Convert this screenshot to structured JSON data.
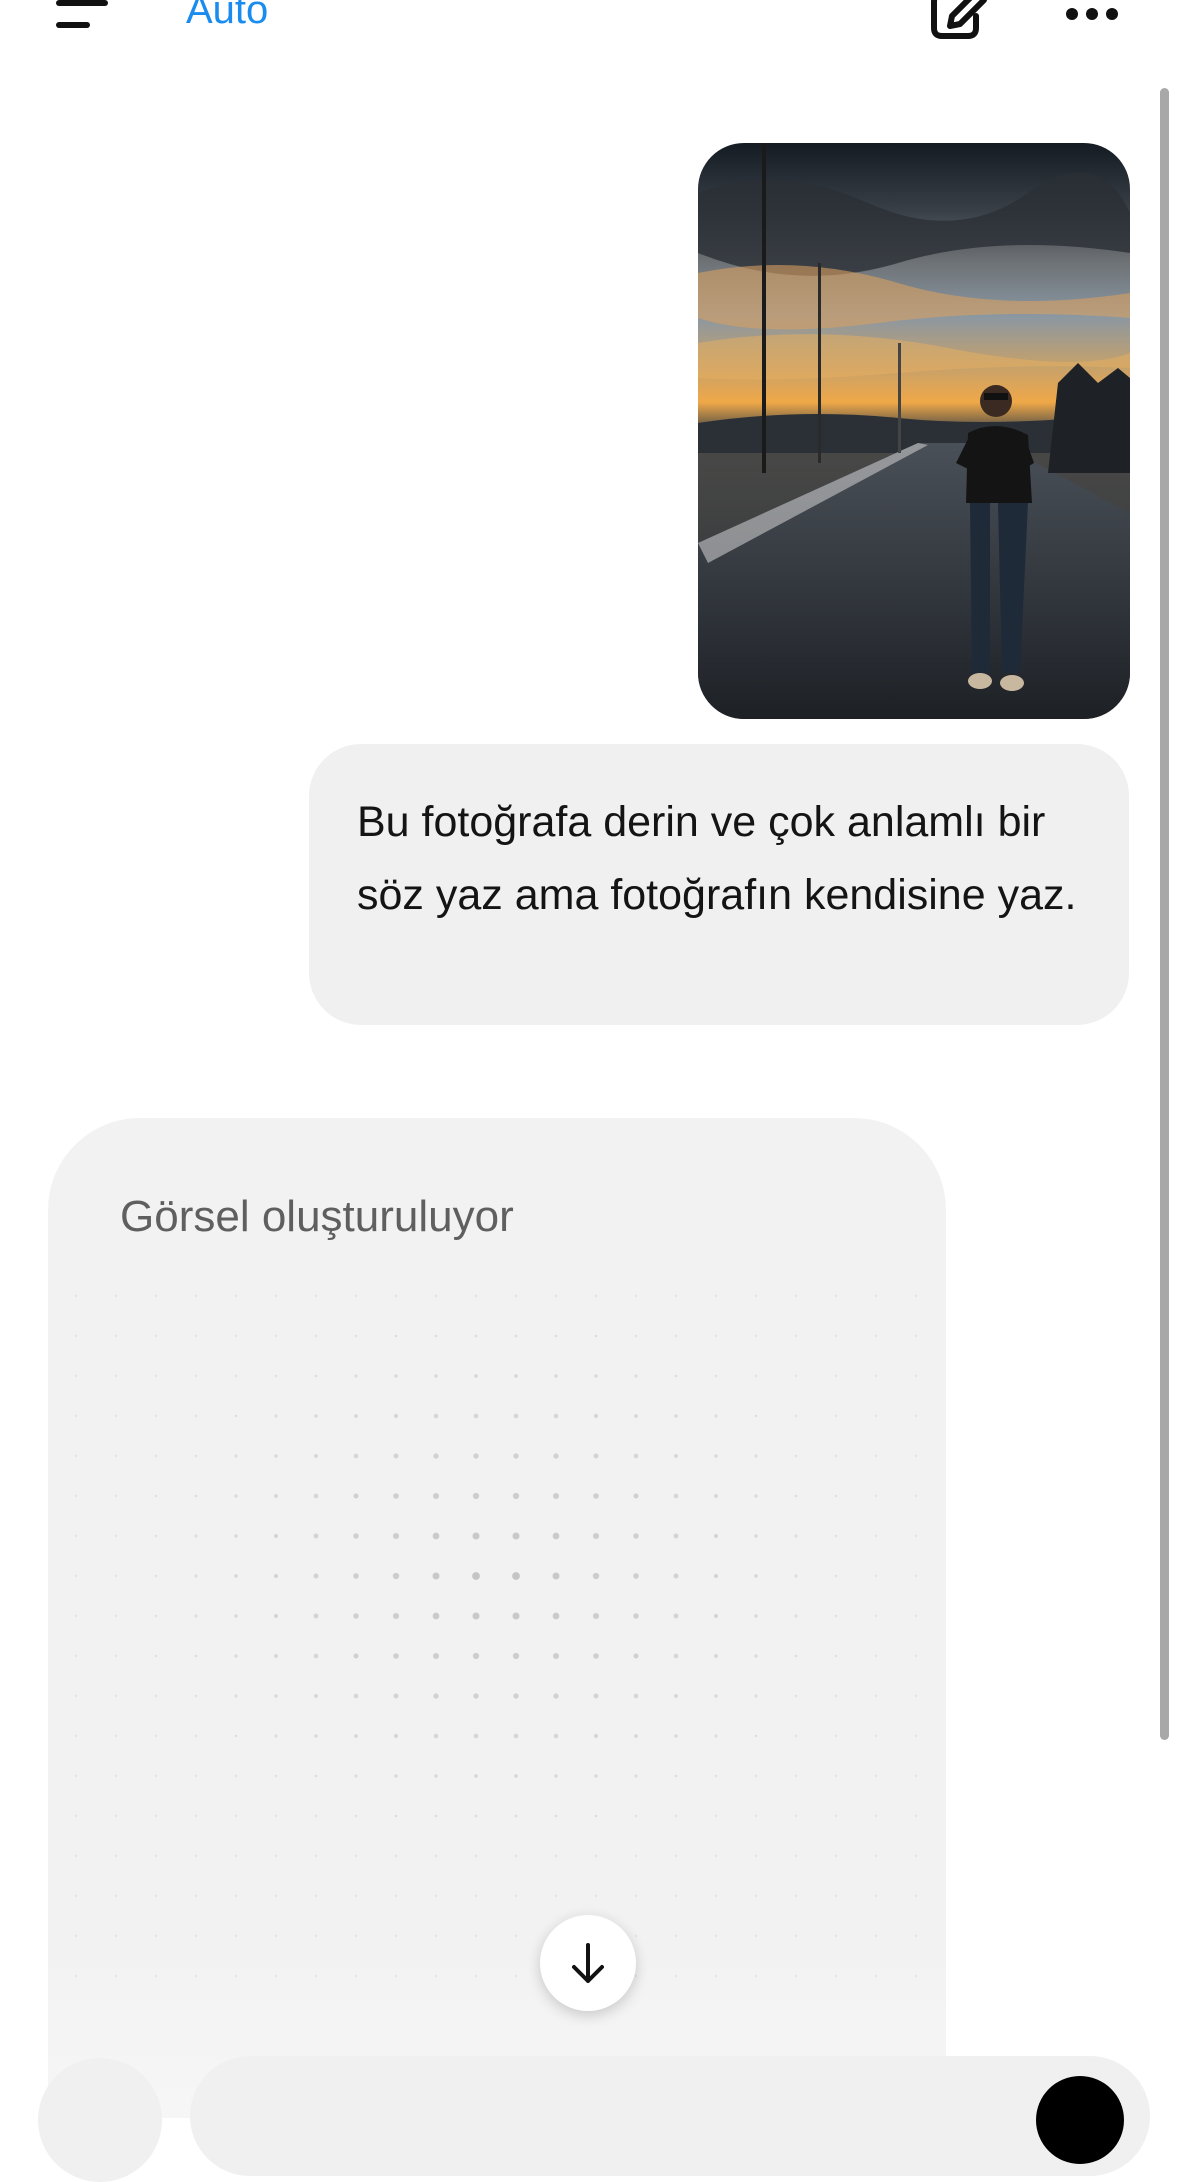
{
  "header": {
    "model_label": "Auto",
    "icons": [
      "menu-icon",
      "new-chat-edit-icon",
      "more-options-icon"
    ]
  },
  "chat": {
    "user_message": {
      "image_description_icon": "attached-photo",
      "text": "Bu fotoğrafa derin ve çok anlamlı bir söz yaz ama fotoğrafın kendisine yaz."
    },
    "assistant_message": {
      "status": "Görsel oluşturuluyor"
    }
  },
  "controls": {
    "scroll_down_icon": "arrow-down-icon"
  },
  "colors": {
    "accent": "#1a8cf0",
    "bubble": "#f0f0f0",
    "text": "#141414",
    "muted": "#5f5f5f"
  }
}
